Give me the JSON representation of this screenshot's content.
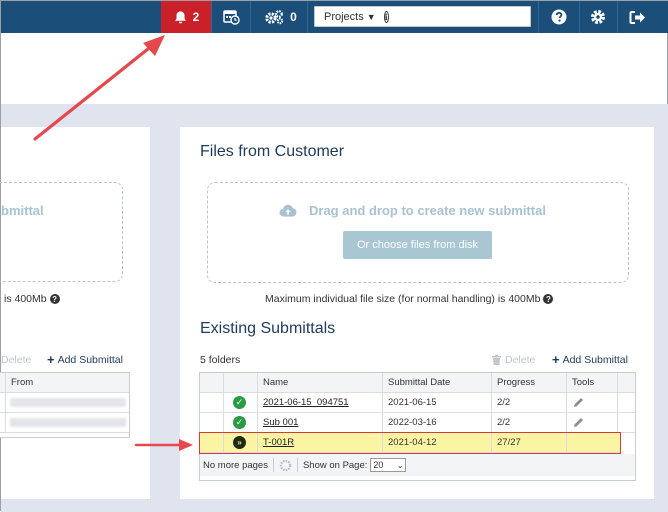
{
  "topbar": {
    "notification_count": "2",
    "background_tasks_count": "0",
    "search": {
      "selected_scope": "Projects",
      "value": ""
    },
    "colors": {
      "bar": "#1b4f7a",
      "notification_bg": "#c9202a"
    },
    "icons": [
      "bell-icon",
      "calendar-clock-icon",
      "gears-icon",
      "info-icon",
      "search-icon",
      "help-icon",
      "settings-icon",
      "logout-icon"
    ]
  },
  "left_panel": {
    "dropzone_text_partial": "bmittal",
    "max_size_partial": "is 400Mb",
    "delete_label": "Delete",
    "add_label": "Add Submittal",
    "from_header": "From"
  },
  "files_from_customer": {
    "title": "Files from Customer",
    "dropzone_text": "Drag and drop to create new submittal",
    "choose_button": "Or choose files from disk",
    "max_size_note": "Maximum individual file size (for normal handling) is 400Mb"
  },
  "existing_submittals": {
    "title": "Existing Submittals",
    "folder_count": "5 folders",
    "delete_label": "Delete",
    "add_label": "Add Submittal",
    "columns": [
      "Name",
      "Submittal Date",
      "Progress",
      "Tools"
    ],
    "rows": [
      {
        "status": "complete",
        "name": "2021-06-15_094751",
        "date": "2021-06-15",
        "progress": "2/2",
        "has_edit": true
      },
      {
        "status": "complete",
        "name": "Sub 001",
        "date": "2022-03-16",
        "progress": "2/2",
        "has_edit": true
      },
      {
        "status": "in-progress",
        "name": "T-001R",
        "date": "2021-04-12",
        "progress": "27/27",
        "has_edit": false,
        "highlighted": true
      }
    ],
    "pager": {
      "status": "No more pages",
      "show_on_page_label": "Show on Page:",
      "page_size": "20"
    }
  }
}
